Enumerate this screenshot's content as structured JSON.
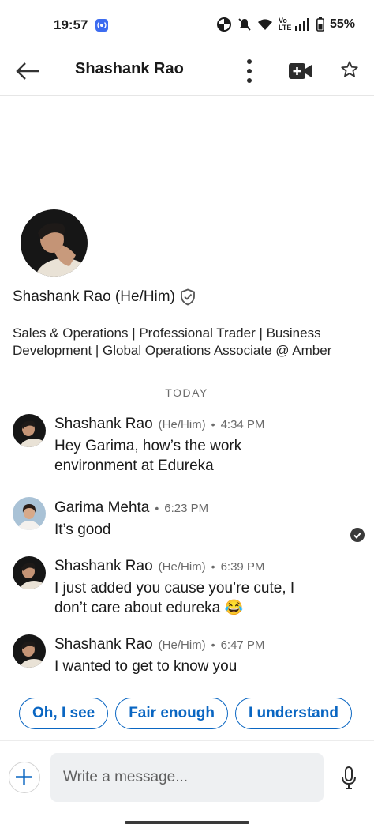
{
  "status_bar": {
    "time": "19:57",
    "battery": "55%",
    "network": "Vo LTE"
  },
  "header": {
    "title": "Shashank Rao"
  },
  "profile": {
    "name": "Shashank Rao (He/Him)",
    "headline": "Sales & Operations | Professional Trader | Business Development | Global Operations Associate @ Amber"
  },
  "divider_label": "TODAY",
  "messages": [
    {
      "sender": "Shashank Rao",
      "pronouns": "(He/Him)",
      "separator": "•",
      "time": "4:34 PM",
      "text": "Hey Garima, how’s the work environment at Edureka"
    },
    {
      "sender": "Garima Mehta",
      "pronouns": "",
      "separator": "•",
      "time": "6:23 PM",
      "text": "It’s good"
    },
    {
      "sender": "Shashank Rao",
      "pronouns": "(He/Him)",
      "separator": "•",
      "time": "6:39 PM",
      "text": "I just added you cause you’re cute, I don’t care about edureka 😂"
    },
    {
      "sender": "Shashank Rao",
      "pronouns": "(He/Him)",
      "separator": "•",
      "time": "6:47 PM",
      "text": "I wanted to get to know you"
    }
  ],
  "quick_replies": [
    "Oh, I see",
    "Fair enough",
    "I understand"
  ],
  "composer": {
    "placeholder": "Write a message..."
  },
  "colors": {
    "accent": "#0a66c2",
    "text": "#1a1a1a",
    "muted": "#6b6b6b",
    "input_bg": "#eef0f2"
  },
  "icons": [
    "back-arrow-icon",
    "more-vertical-icon",
    "video-add-icon",
    "star-icon",
    "verified-shield-icon",
    "read-check-icon",
    "plus-icon",
    "microphone-icon"
  ]
}
